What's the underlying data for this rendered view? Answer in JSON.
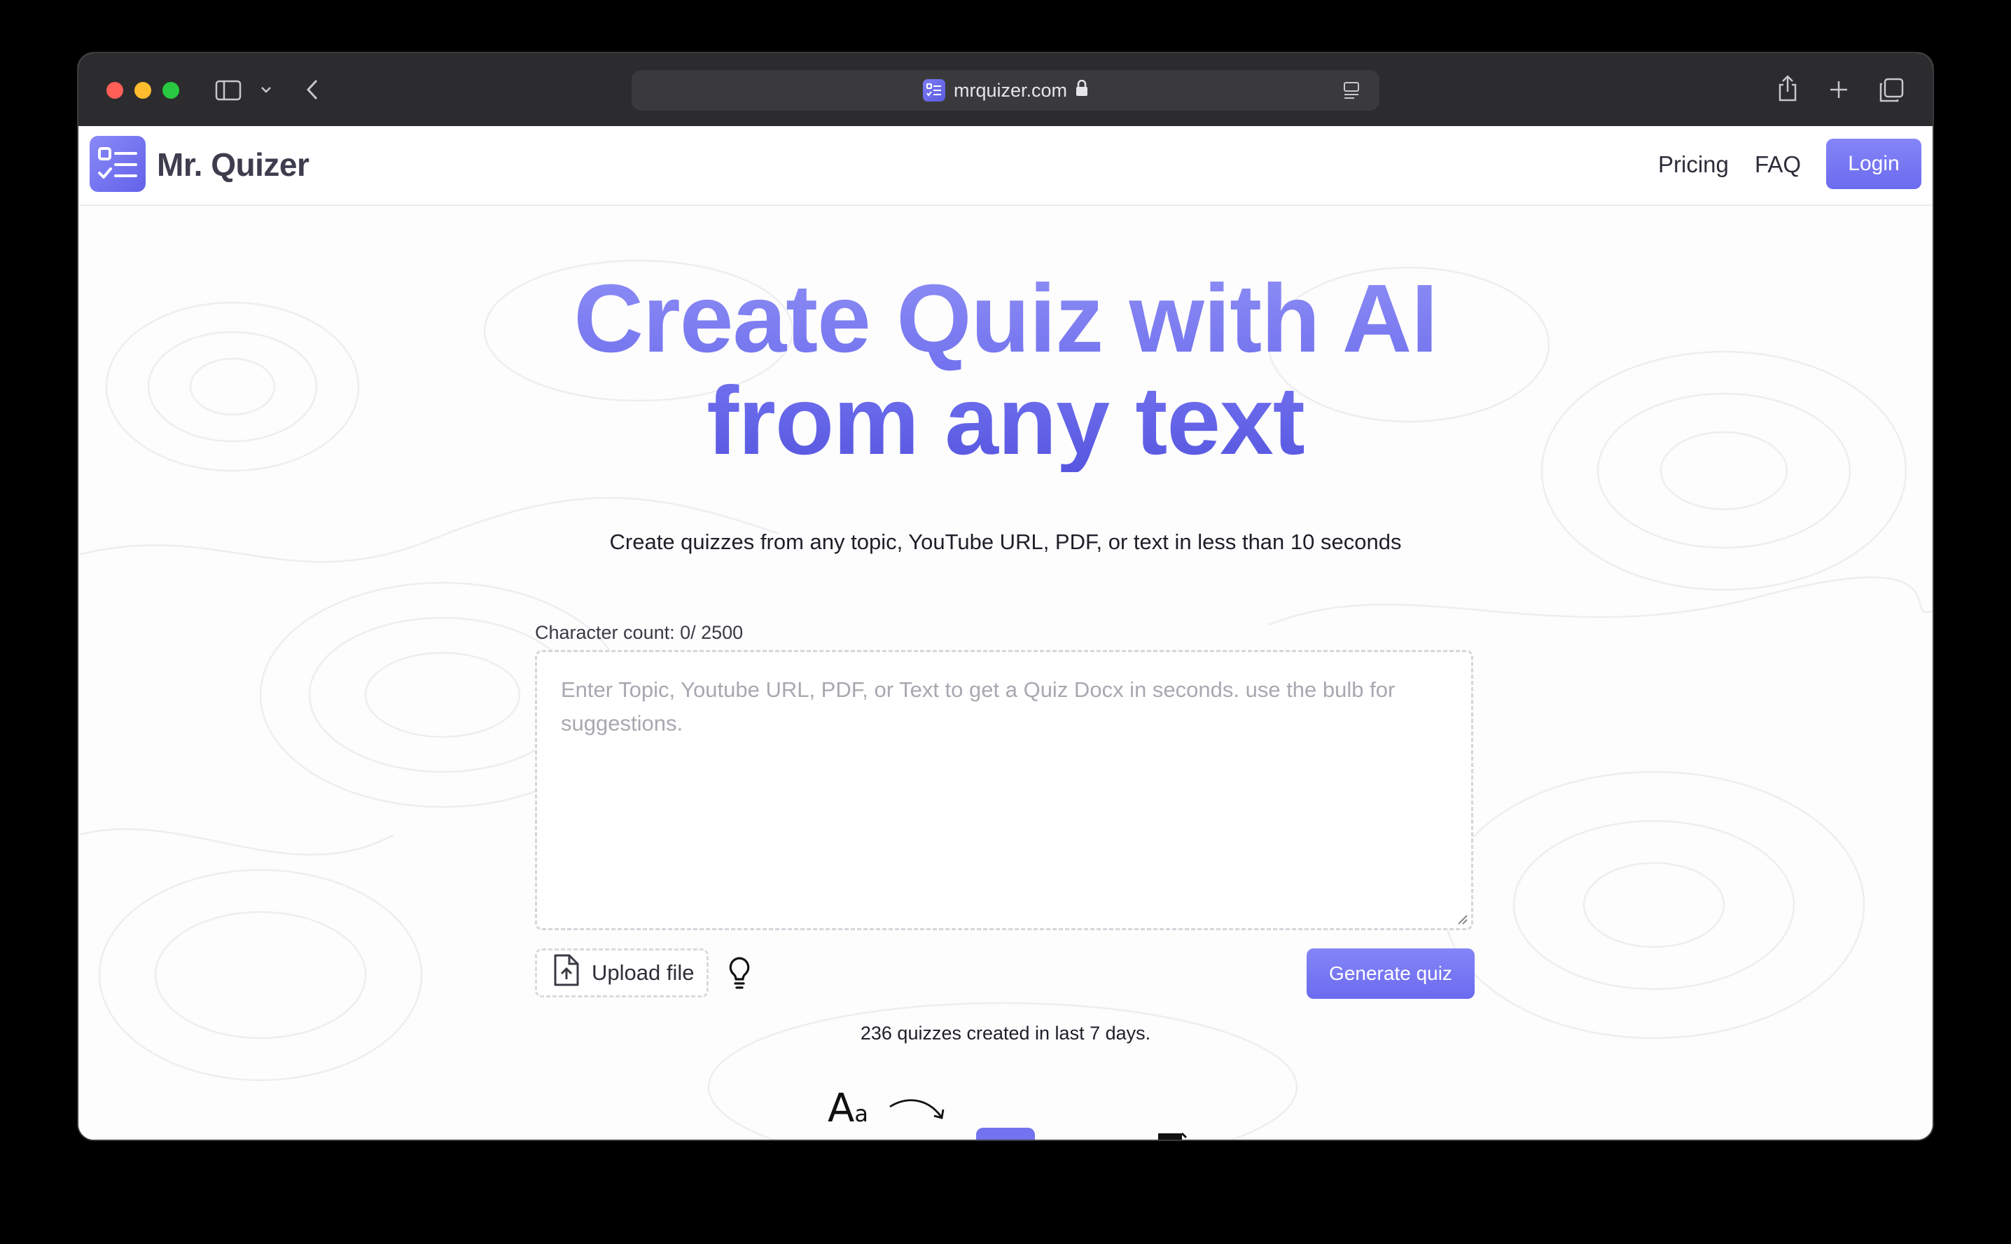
{
  "browser": {
    "url": "mrquizer.com",
    "icons": [
      "sidebar-icon",
      "chevron-down-icon",
      "back-icon",
      "lock-icon",
      "reader-icon",
      "share-icon",
      "new-tab-icon",
      "tabs-overview-icon"
    ]
  },
  "header": {
    "brand": "Mr. Quizer",
    "nav": {
      "pricing": "Pricing",
      "faq": "FAQ"
    },
    "login_label": "Login"
  },
  "hero": {
    "title_line1": "Create Quiz with AI",
    "title_line2": "from any text",
    "subtitle": "Create quizzes from any topic, YouTube URL, PDF, or text in less than 10 seconds"
  },
  "form": {
    "char_count": "Character count: 0/ 2500",
    "placeholder": "Enter Topic, Youtube URL, PDF, or Text to get a Quiz Docx in seconds. use the bulb for suggestions.",
    "value": "",
    "upload_label": "Upload file",
    "generate_label": "Generate quiz"
  },
  "stats": {
    "text": "236 quizzes created in last 7 days."
  },
  "illustration": {
    "aa_big": "A",
    "aa_small": "a"
  },
  "colors": {
    "accent": "#7070ee",
    "accent_light": "#8585f8",
    "chrome_bg": "#2c2c2e"
  }
}
